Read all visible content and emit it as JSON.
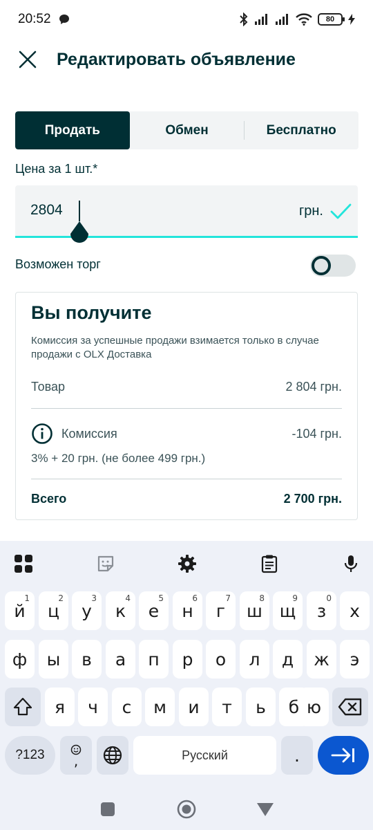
{
  "status": {
    "time": "20:52",
    "battery": "80"
  },
  "header": {
    "title": "Редактировать объявление"
  },
  "tabs": [
    {
      "label": "Продать",
      "active": true
    },
    {
      "label": "Обмен",
      "active": false
    },
    {
      "label": "Бесплатно",
      "active": false
    }
  ],
  "price": {
    "label": "Цена за 1 шт.*",
    "value": "2804",
    "currency": "грн."
  },
  "bargain": {
    "label": "Возможен торг",
    "enabled": false
  },
  "summary": {
    "title": "Вы получите",
    "note": "Комиссия за успешные продажи взимается только в случае продажи с OLX Доставка",
    "goods_label": "Товар",
    "goods_value": "2 804 грн.",
    "fee_label": "Комиссия",
    "fee_value": "-104 грн.",
    "fee_rule": "3% + 20 грн. (не более 499 грн.)",
    "total_label": "Всего",
    "total_value": "2 700 грн."
  },
  "keyboard": {
    "row1": [
      {
        "c": "й",
        "n": "1"
      },
      {
        "c": "ц",
        "n": "2"
      },
      {
        "c": "у",
        "n": "3"
      },
      {
        "c": "к",
        "n": "4"
      },
      {
        "c": "е",
        "n": "5"
      },
      {
        "c": "н",
        "n": "6"
      },
      {
        "c": "г",
        "n": "7"
      },
      {
        "c": "ш",
        "n": "8"
      },
      {
        "c": "щ",
        "n": "9"
      },
      {
        "c": "з",
        "n": "0"
      },
      {
        "c": "х",
        "n": ""
      }
    ],
    "row2": [
      "ф",
      "ы",
      "в",
      "а",
      "п",
      "р",
      "о",
      "л",
      "д",
      "ж",
      "э"
    ],
    "row3": [
      "я",
      "ч",
      "с",
      "м",
      "и",
      "т",
      "ь",
      "б",
      "ю"
    ],
    "sym_label": "?123",
    "comma": ",",
    "space_label": "Русский",
    "period": "."
  },
  "colors": {
    "brand_dark": "#002f34",
    "accent_teal": "#23e5db",
    "enter_blue": "#0b57d0"
  }
}
